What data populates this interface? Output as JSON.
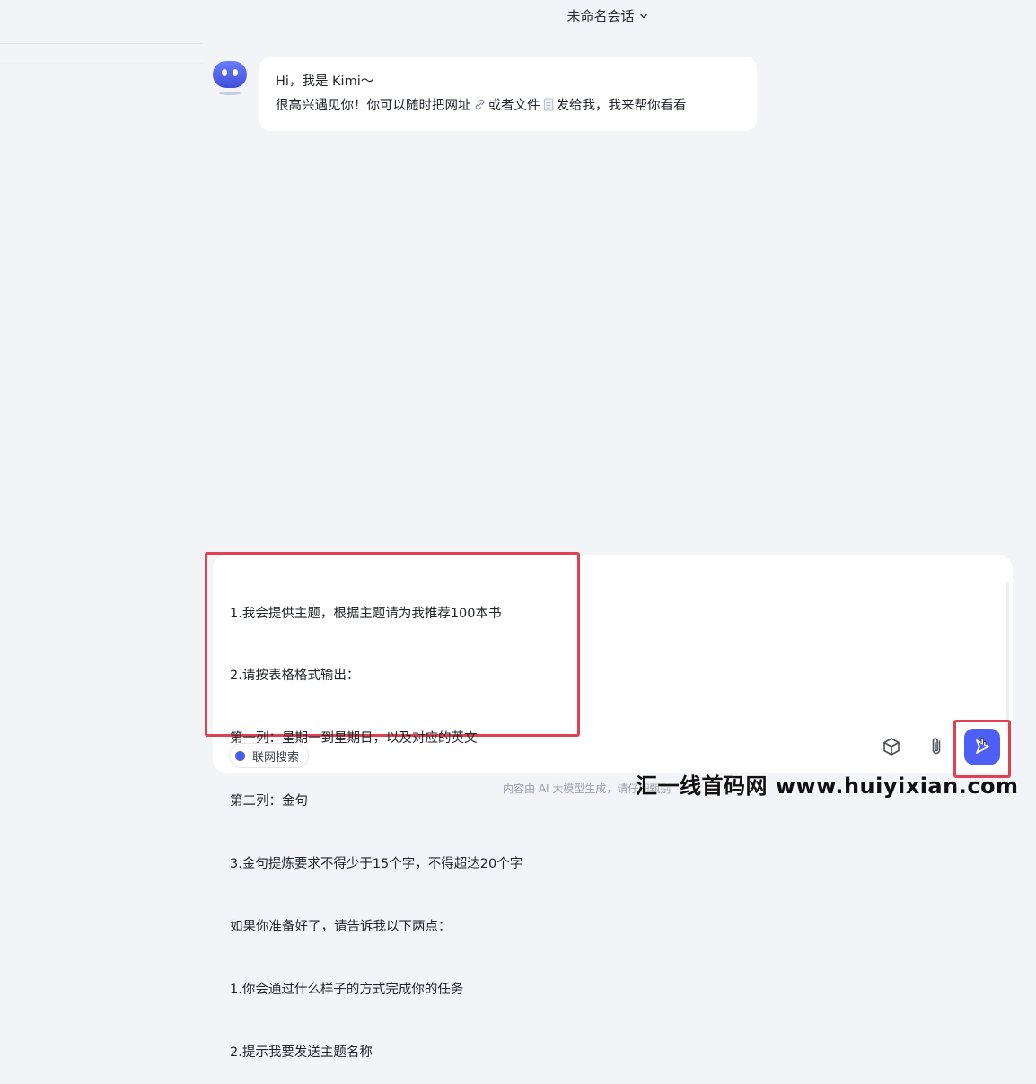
{
  "header": {
    "title": "未命名会话"
  },
  "assistant_message": {
    "line1": "Hi，我是 Kimi～",
    "line2_part1": "很高兴遇见你！你可以随时把网址",
    "line2_part2": "或者文件",
    "line2_part3": "发给我，我来帮你看看"
  },
  "composer": {
    "lines": [
      "1.我会提供主题，根据主题请为我推荐100本书",
      "2.请按表格格式输出：",
      "第一列：星期一到星期日，以及对应的英文",
      "第二列：金句",
      "3.金句提炼要求不得少于15个字，不得超达20个字",
      "如果你准备好了，请告诉我以下两点：",
      "1.你会通过什么样子的方式完成你的任务",
      "2.提示我要发送主题名称"
    ],
    "web_search_label": "联网搜索"
  },
  "footer": {
    "note": "内容由 AI 大模型生成，请仔细甄别"
  },
  "watermark": {
    "text": "汇一线首码网 www.huiyixian.com"
  },
  "colors": {
    "accent": "#4e5ff5",
    "highlight": "#e0404f",
    "background": "#f3f4f8"
  },
  "icons": {
    "chevron": "chevron-down-icon",
    "link": "link-icon",
    "file": "file-icon",
    "cube": "cube-icon",
    "attach": "paperclip-icon",
    "send": "send-icon"
  }
}
